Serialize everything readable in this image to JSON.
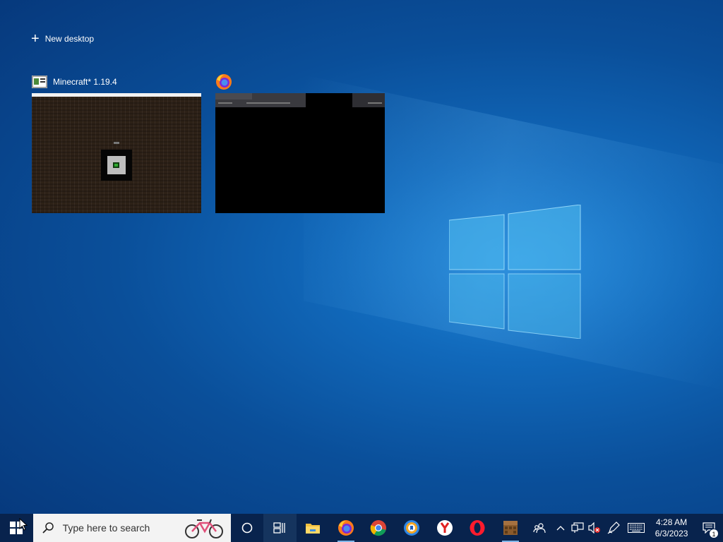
{
  "task_view": {
    "new_desktop_label": "New desktop",
    "windows": [
      {
        "title": "Minecraft* 1.19.4",
        "icon": "minecraft-launcher-icon"
      },
      {
        "title": "",
        "icon": "firefox-icon"
      }
    ]
  },
  "taskbar": {
    "start_icon": "windows-start-icon",
    "search_placeholder": "Type here to search",
    "search_highlight": "bike-icon",
    "buttons": [
      {
        "name": "cortana-icon"
      },
      {
        "name": "task-view-icon",
        "active": true
      },
      {
        "name": "file-explorer-icon"
      },
      {
        "name": "firefox-icon",
        "running": true
      },
      {
        "name": "chrome-icon"
      },
      {
        "name": "avast-browser-icon"
      },
      {
        "name": "yandex-browser-icon"
      },
      {
        "name": "opera-icon"
      },
      {
        "name": "minecraft-launcher-icon",
        "running": true
      }
    ],
    "tray": {
      "people_icon": "people-icon",
      "overflow_icon": "chevron-up-icon",
      "network_icon": "network-icon",
      "volume_icon": "volume-muted-icon",
      "pen_icon": "pen-icon",
      "keyboard_icon": "keyboard-icon",
      "time": "4:28 AM",
      "date": "6/3/2023",
      "notification_count": "1"
    }
  },
  "colors": {
    "taskbar": "#08234d",
    "desktop": "#0a4f9a",
    "accent": "#7fb6ea"
  }
}
